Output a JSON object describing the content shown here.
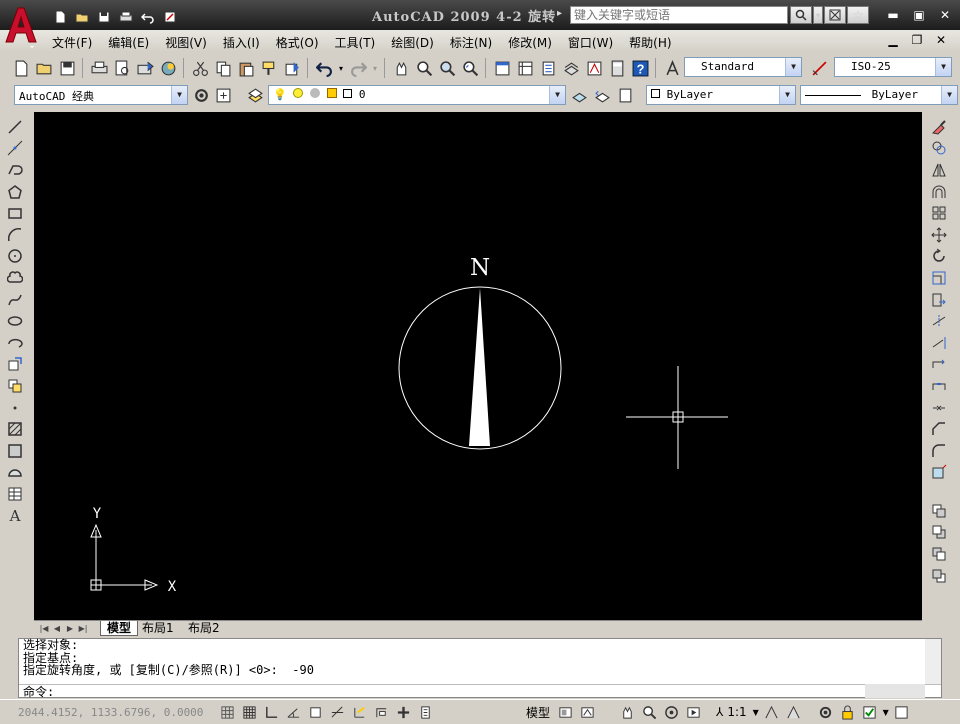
{
  "titlebar": {
    "title": "AutoCAD 2009  4-2 旋转",
    "search_placeholder": "键入关键字或短语",
    "search_arrow": "▸"
  },
  "menu": {
    "items": [
      {
        "id": "file",
        "label": "文件(F)"
      },
      {
        "id": "edit",
        "label": "编辑(E)"
      },
      {
        "id": "view",
        "label": "视图(V)"
      },
      {
        "id": "insert",
        "label": "插入(I)"
      },
      {
        "id": "format",
        "label": "格式(O)"
      },
      {
        "id": "tools",
        "label": "工具(T)"
      },
      {
        "id": "draw",
        "label": "绘图(D)"
      },
      {
        "id": "dimension",
        "label": "标注(N)"
      },
      {
        "id": "modify",
        "label": "修改(M)"
      },
      {
        "id": "window",
        "label": "窗口(W)"
      },
      {
        "id": "help",
        "label": "帮助(H)"
      }
    ]
  },
  "toolbars": {
    "text_style": "Standard",
    "dim_style": "ISO-25",
    "workspace": "AutoCAD 经典",
    "layer": "0",
    "color": "ByLayer",
    "linetype": "ByLayer"
  },
  "drawing": {
    "north_label": "N",
    "ucs_x": "X",
    "ucs_y": "Y"
  },
  "layout_tabs": [
    {
      "id": "model",
      "label": "模型"
    },
    {
      "id": "layout1",
      "label": "布局1"
    },
    {
      "id": "layout2",
      "label": "布局2"
    }
  ],
  "command": {
    "history": [
      "选择对象:",
      "指定基点:",
      "指定旋转角度, 或 [复制(C)/参照(R)] <0>:  -90"
    ],
    "prompt": "命令:"
  },
  "status": {
    "coordinates": "2044.4152, 1133.6796, 0.0000",
    "model_label": "模型",
    "annotation_scale": "1:1",
    "annotation_scale_prefix": "⅄"
  },
  "colors": {
    "canvas": "#000000",
    "title_bg": "#2a2a2a",
    "logo_red": "#c8102e",
    "drawing_line": "#ffffff"
  }
}
